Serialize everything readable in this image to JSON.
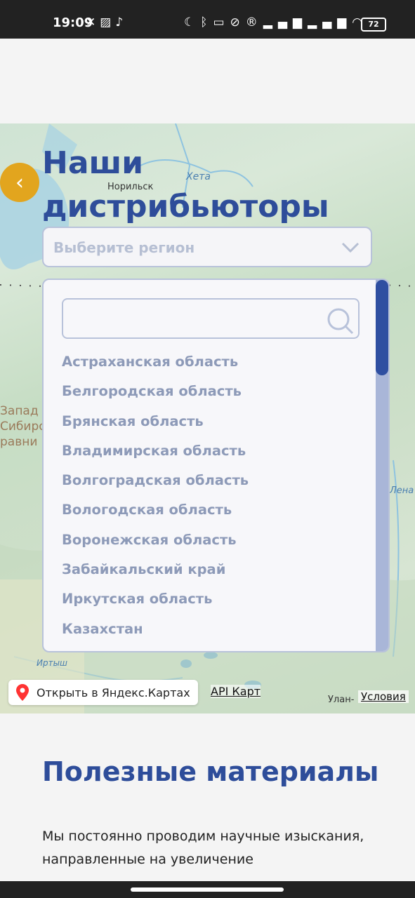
{
  "status_bar": {
    "time": "19:09",
    "left_icons": [
      "x-icon",
      "gallery-icon",
      "tiktok-icon"
    ],
    "right_icons": [
      "moon-icon",
      "bluetooth-icon",
      "vibrate-icon",
      "mute-icon",
      "r-icon",
      "signal-icon",
      "signal-icon",
      "wifi-icon"
    ],
    "battery": "72"
  },
  "map": {
    "labels": [
      "Норильск",
      "Хета",
      "Запад",
      "Сибиро",
      "равни",
      "Иртыш",
      "Улан-",
      "Лена"
    ],
    "open_in_yandex": "Открыть в Яндекс.Картах",
    "api_link": "API Карт",
    "terms_link": "Условия"
  },
  "distributors": {
    "title_line1": "Наши",
    "title_line2": "дистрибьюторы",
    "region_placeholder": "Выберите регион",
    "regions": [
      "Астраханская область",
      "Белгородская область",
      "Брянская область",
      "Владимирская область",
      "Волгоградская область",
      "Вологодская область",
      "Воронежская область",
      "Забайкальский край",
      "Иркутская область",
      "Казахстан"
    ]
  },
  "materials": {
    "title": "Полезные материалы",
    "text": "Мы постоянно проводим научные изыскания, направленные на увеличение"
  },
  "colors": {
    "accent": "#2e4d9a",
    "back_button": "#e2a51e",
    "scroll_thumb": "#2f4fa1"
  }
}
